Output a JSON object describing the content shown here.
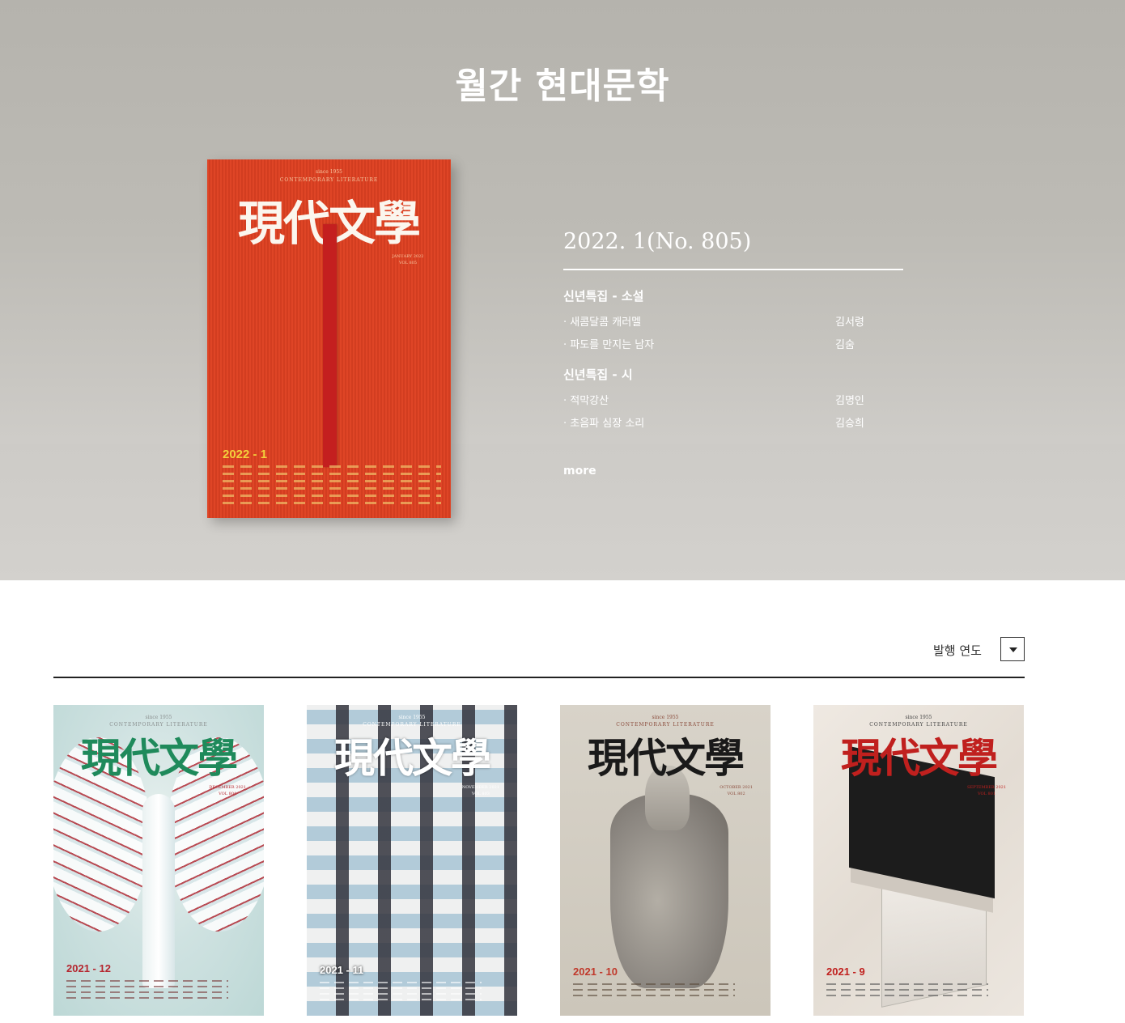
{
  "page": {
    "title": "월간 현대문학"
  },
  "featured": {
    "cover": {
      "since": "since 1955",
      "subtitle": "CONTEMPORARY LITERATURE",
      "logo": "現代文學",
      "date_line1": "JANUARY 2022",
      "date_line2": "VOL 805",
      "issue": "2022 - 1"
    },
    "issue_title": "2022. 1(No. 805)",
    "sections": [
      {
        "label": "신년특집 - 소설",
        "items": [
          {
            "title": "· 새콤달콤 캐러멜",
            "author": "김서령"
          },
          {
            "title": "· 파도를 만지는 남자",
            "author": "김숨"
          }
        ]
      },
      {
        "label": "신년특집 - 시",
        "items": [
          {
            "title": "· 적막강산",
            "author": "김명인"
          },
          {
            "title": "· 초음파 심장 소리",
            "author": "김승희"
          }
        ]
      }
    ],
    "more_label": "more"
  },
  "filter": {
    "label": "발행 연도",
    "icon": "caret-down-icon"
  },
  "covers": [
    {
      "since": "since 1955",
      "subtitle": "CONTEMPORARY LITERATURE",
      "logo": "現代文學",
      "date_line1": "DECEMBER 2021",
      "date_line2": "VOL 804",
      "issue": "2021 - 12",
      "logo_color": "#1f8a5b",
      "issue_color": "#b5262f"
    },
    {
      "since": "since 1955",
      "subtitle": "CONTEMPORARY LITERATURE",
      "logo": "現代文學",
      "date_line1": "NOVEMBER 2021",
      "date_line2": "VOL 803",
      "issue": "2021 - 11",
      "logo_color": "#ffffff",
      "issue_color": "#ffffff"
    },
    {
      "since": "since 1955",
      "subtitle": "CONTEMPORARY LITERATURE",
      "logo": "現代文學",
      "date_line1": "OCTOBER 2021",
      "date_line2": "VOL 802",
      "issue": "2021 - 10",
      "logo_color": "#1a1a1a",
      "issue_color": "#c0392b"
    },
    {
      "since": "since 1955",
      "subtitle": "CONTEMPORARY LITERATURE",
      "logo": "現代文學",
      "date_line1": "SEPTEMBER 2021",
      "date_line2": "VOL 801",
      "issue": "2021 - 9",
      "logo_color": "#c0201e",
      "issue_color": "#c0201e"
    }
  ]
}
